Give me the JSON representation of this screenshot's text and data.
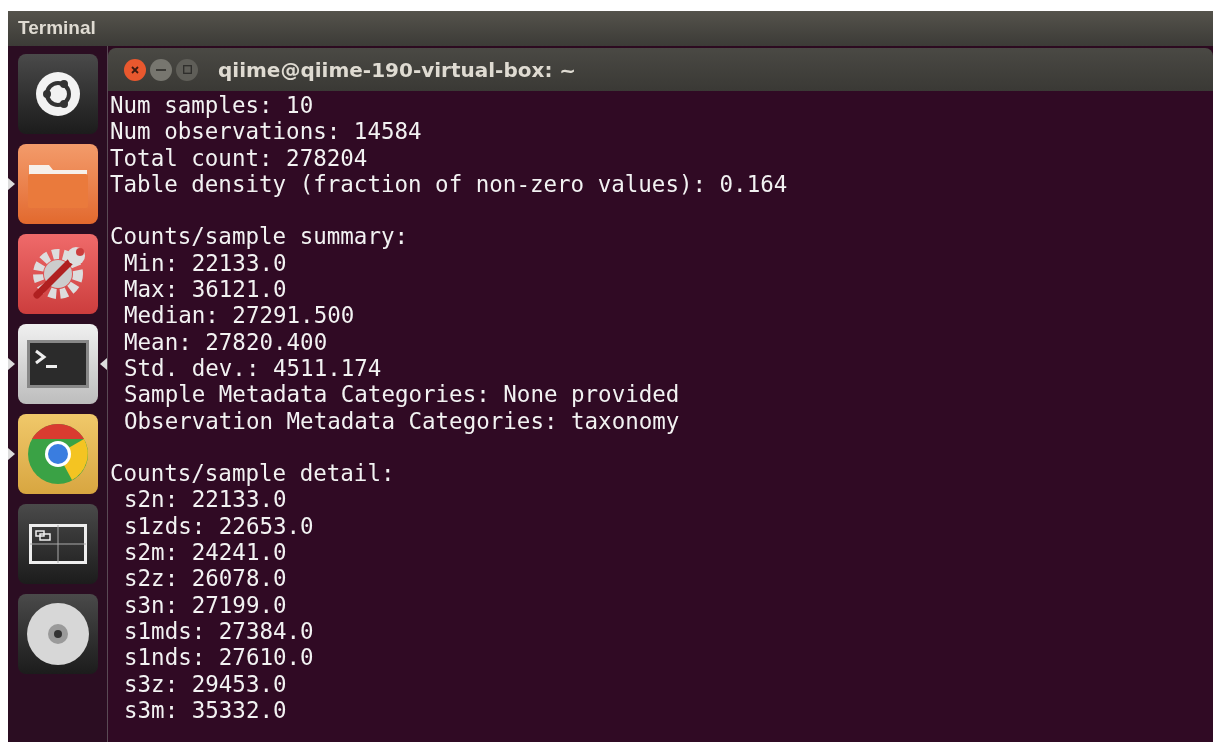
{
  "top_bar": {
    "title": "Terminal"
  },
  "launcher": [
    {
      "kind": "dash",
      "running": false,
      "focused": false
    },
    {
      "kind": "files",
      "running": true,
      "focused": false
    },
    {
      "kind": "settings",
      "running": false,
      "focused": false
    },
    {
      "kind": "terminal",
      "running": true,
      "focused": true
    },
    {
      "kind": "browser",
      "running": true,
      "focused": false
    },
    {
      "kind": "workspaces",
      "running": false,
      "focused": false
    },
    {
      "kind": "disc",
      "running": false,
      "focused": false
    }
  ],
  "window": {
    "title": "qiime@qiime-190-virtual-box: ~"
  },
  "terminal_output": [
    {
      "lines": [
        {
          "text": "Num samples: 10",
          "indent": false
        },
        {
          "text": "Num observations: 14584",
          "indent": false
        },
        {
          "text": "Total count: 278204",
          "indent": false
        },
        {
          "text": "Table density (fraction of non-zero values): 0.164",
          "indent": false
        }
      ]
    },
    {
      "lines": [
        {
          "text": "Counts/sample summary:",
          "indent": false
        },
        {
          "text": "Min: 22133.0",
          "indent": true
        },
        {
          "text": "Max: 36121.0",
          "indent": true
        },
        {
          "text": "Median: 27291.500",
          "indent": true
        },
        {
          "text": "Mean: 27820.400",
          "indent": true
        },
        {
          "text": "Std. dev.: 4511.174",
          "indent": true
        },
        {
          "text": "Sample Metadata Categories: None provided",
          "indent": true
        },
        {
          "text": "Observation Metadata Categories: taxonomy",
          "indent": true
        }
      ]
    },
    {
      "lines": [
        {
          "text": "Counts/sample detail:",
          "indent": false
        },
        {
          "text": "s2n: 22133.0",
          "indent": true
        },
        {
          "text": "s1zds: 22653.0",
          "indent": true
        },
        {
          "text": "s2m: 24241.0",
          "indent": true
        },
        {
          "text": "s2z: 26078.0",
          "indent": true
        },
        {
          "text": "s3n: 27199.0",
          "indent": true
        },
        {
          "text": "s1mds: 27384.0",
          "indent": true
        },
        {
          "text": "s1nds: 27610.0",
          "indent": true
        },
        {
          "text": "s3z: 29453.0",
          "indent": true
        },
        {
          "text": "s3m: 35332.0",
          "indent": true
        }
      ]
    }
  ]
}
